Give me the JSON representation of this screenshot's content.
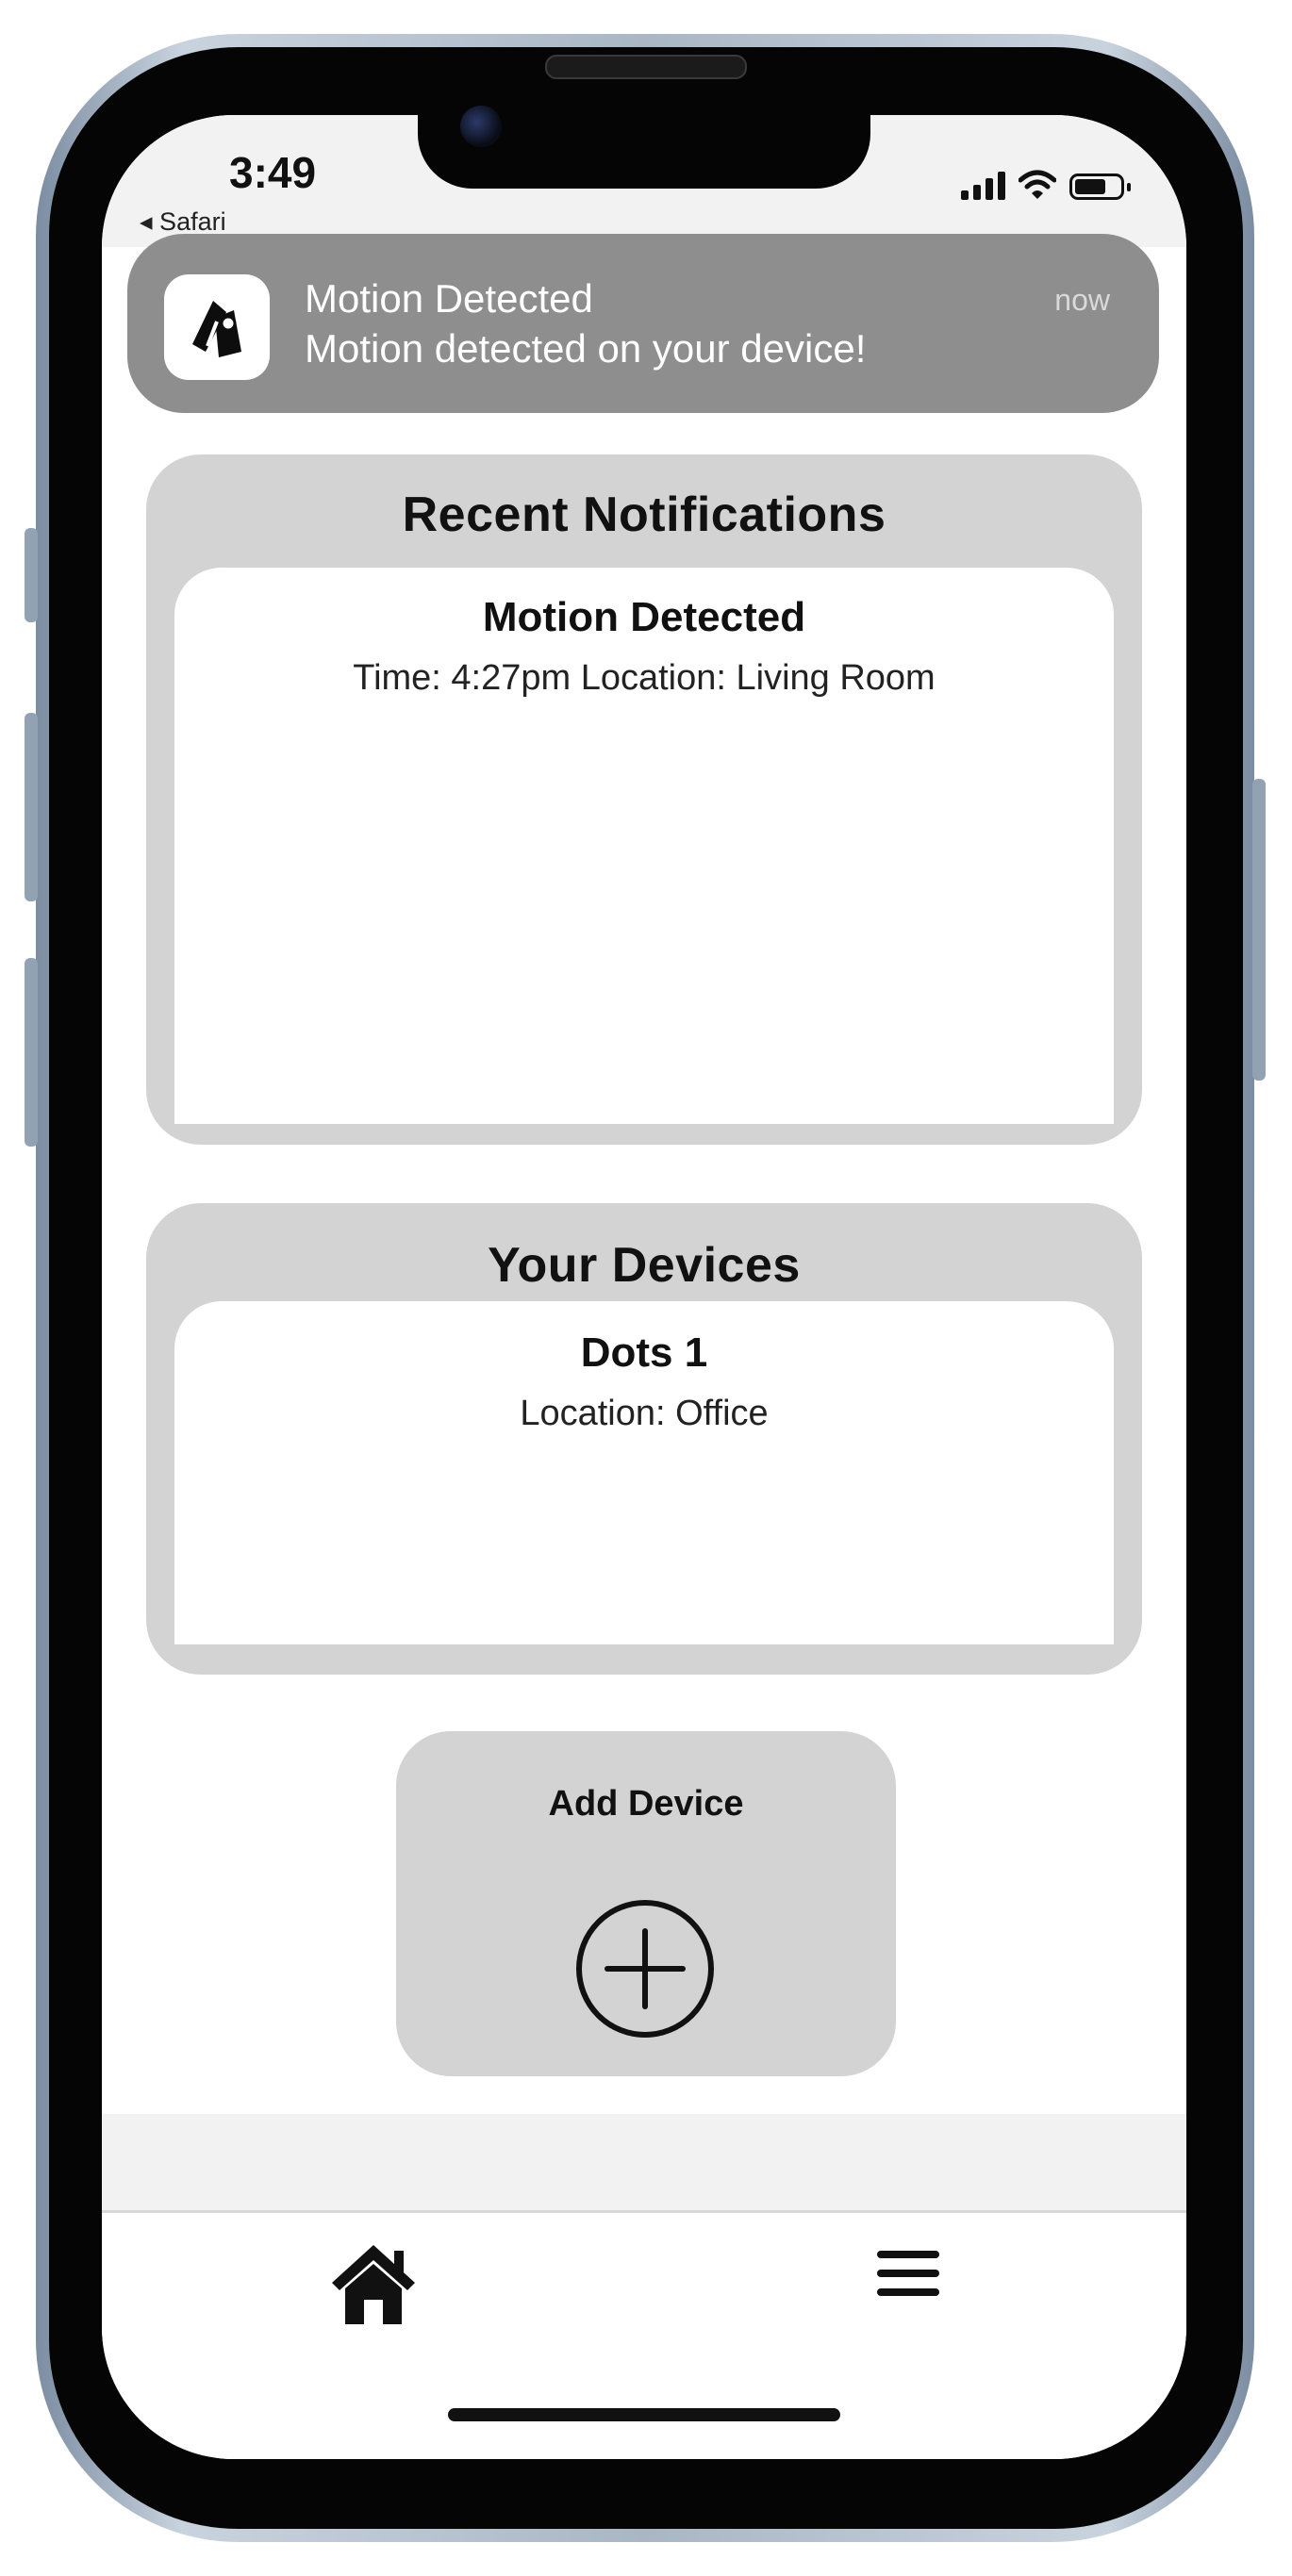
{
  "status_bar": {
    "time": "3:49",
    "back_app": "◂ Safari",
    "icons": [
      "signal-icon",
      "wifi-icon",
      "battery-icon"
    ]
  },
  "notification_banner": {
    "title": "Motion Detected",
    "body": "Motion detected on your device!",
    "time": "now",
    "app_icon": "app-logo-icon"
  },
  "recent_notifications": {
    "heading": "Recent Notifications",
    "items": [
      {
        "title": "Motion Detected",
        "detail": "Time: 4:27pm  Location: Living Room"
      }
    ]
  },
  "devices": {
    "heading": "Your Devices",
    "items": [
      {
        "name": "Dots 1",
        "location": "Location: Office"
      }
    ]
  },
  "add_device": {
    "label": "Add Device",
    "icon": "plus-circle-icon"
  },
  "tab_bar": {
    "items": [
      {
        "icon": "home-icon"
      },
      {
        "icon": "menu-icon"
      }
    ]
  },
  "colors": {
    "banner": "#8e8e8e",
    "card": "#d3d3d3",
    "frame": "#050505"
  }
}
